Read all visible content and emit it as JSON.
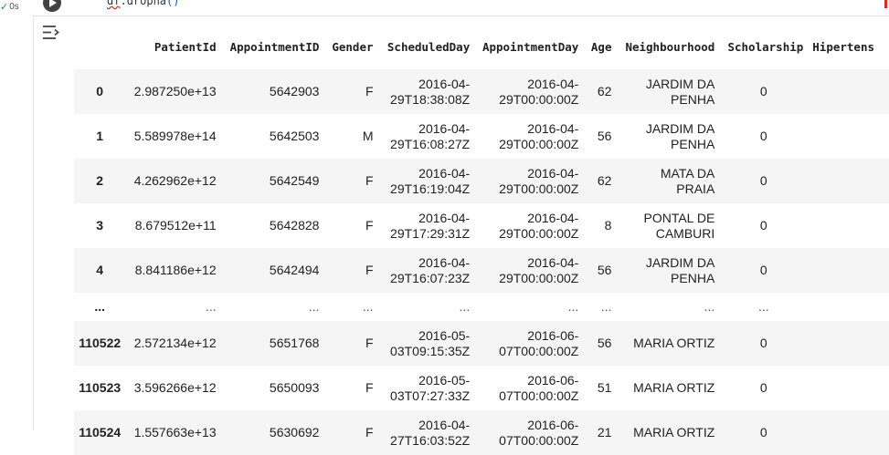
{
  "exec": {
    "duration": "0s"
  },
  "code": {
    "prefix": "df",
    "sep": ".",
    "method": "dropna",
    "call": "()"
  },
  "table": {
    "columns": [
      "",
      "PatientId",
      "AppointmentID",
      "Gender",
      "ScheduledDay",
      "AppointmentDay",
      "Age",
      "Neighbourhood",
      "Scholarship",
      "Hipertens"
    ],
    "rows": [
      [
        "0",
        "2.987250e+13",
        "5642903",
        "F",
        "2016-04-29T18:38:08Z",
        "2016-04-29T00:00:00Z",
        "62",
        "JARDIM DA PENHA",
        "0",
        ""
      ],
      [
        "1",
        "5.589978e+14",
        "5642503",
        "M",
        "2016-04-29T16:08:27Z",
        "2016-04-29T00:00:00Z",
        "56",
        "JARDIM DA PENHA",
        "0",
        ""
      ],
      [
        "2",
        "4.262962e+12",
        "5642549",
        "F",
        "2016-04-29T16:19:04Z",
        "2016-04-29T00:00:00Z",
        "62",
        "MATA DA PRAIA",
        "0",
        ""
      ],
      [
        "3",
        "8.679512e+11",
        "5642828",
        "F",
        "2016-04-29T17:29:31Z",
        "2016-04-29T00:00:00Z",
        "8",
        "PONTAL DE CAMBURI",
        "0",
        ""
      ],
      [
        "4",
        "8.841186e+12",
        "5642494",
        "F",
        "2016-04-29T16:07:23Z",
        "2016-04-29T00:00:00Z",
        "56",
        "JARDIM DA PENHA",
        "0",
        ""
      ],
      [
        "...",
        "...",
        "...",
        "...",
        "...",
        "...",
        "...",
        "...",
        "...",
        ""
      ],
      [
        "110522",
        "2.572134e+12",
        "5651768",
        "F",
        "2016-05-03T09:15:35Z",
        "2016-06-07T00:00:00Z",
        "56",
        "MARIA ORTIZ",
        "0",
        ""
      ],
      [
        "110523",
        "3.596266e+12",
        "5650093",
        "F",
        "2016-05-03T07:27:33Z",
        "2016-06-07T00:00:00Z",
        "51",
        "MARIA ORTIZ",
        "0",
        ""
      ],
      [
        "110524",
        "1.557663e+13",
        "5630692",
        "F",
        "2016-04-27T16:03:52Z",
        "2016-06-07T00:00:00Z",
        "21",
        "MARIA ORTIZ",
        "0",
        ""
      ]
    ]
  },
  "colors": {
    "stripe": "#f5f5f5",
    "run_button": "#424242",
    "error_marker": "#d93025"
  }
}
